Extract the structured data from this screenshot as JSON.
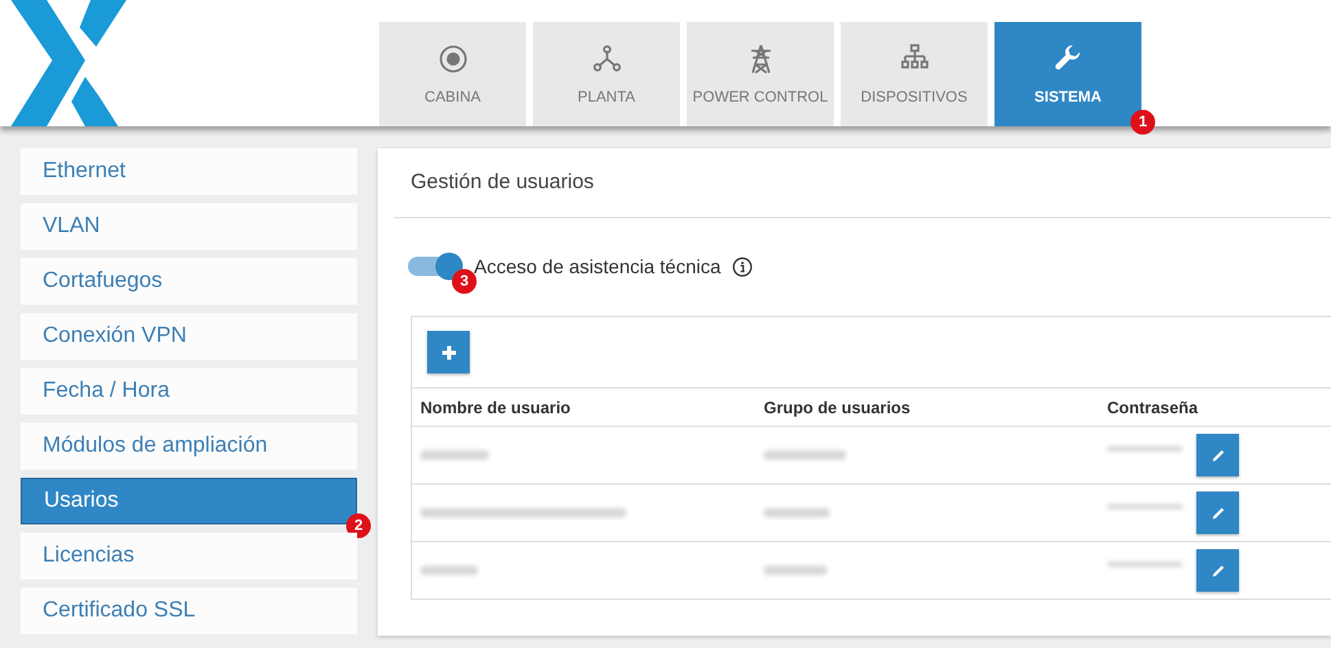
{
  "tabs": [
    {
      "label": "CABINA",
      "selected": false
    },
    {
      "label": "PLANTA",
      "selected": false
    },
    {
      "label": "POWER CONTROL",
      "selected": false
    },
    {
      "label": "DISPOSITIVOS",
      "selected": false
    },
    {
      "label": "SISTEMA",
      "selected": true,
      "badge": "1"
    }
  ],
  "sidebar": {
    "items": [
      {
        "label": "Ethernet",
        "selected": false
      },
      {
        "label": "VLAN",
        "selected": false
      },
      {
        "label": "Cortafuegos",
        "selected": false
      },
      {
        "label": "Conexión VPN",
        "selected": false
      },
      {
        "label": "Fecha / Hora",
        "selected": false
      },
      {
        "label": "Módulos de ampliación",
        "selected": false
      },
      {
        "label": "Usarios",
        "selected": true,
        "badge": "2"
      },
      {
        "label": "Licencias",
        "selected": false
      },
      {
        "label": "Certificado SSL",
        "selected": false
      }
    ]
  },
  "panel": {
    "title": "Gestión de usuarios",
    "toggle": {
      "label": "Acceso de asistencia técnica",
      "on": true,
      "badge": "3"
    },
    "table": {
      "columns": [
        "Nombre de usuario",
        "Grupo de usuarios",
        "Contraseña"
      ]
    }
  }
}
